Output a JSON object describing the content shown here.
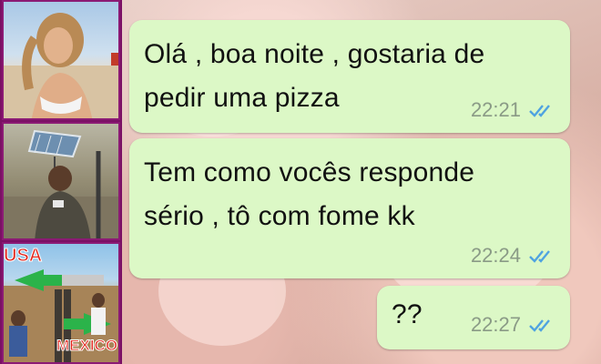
{
  "thumbnails": [
    {
      "name": "woman-on-beach-photo"
    },
    {
      "name": "man-with-solar-panel-photo"
    },
    {
      "name": "usa-mexico-border-photo",
      "labels": {
        "usa": "USA",
        "mexico": "MEXICO"
      }
    }
  ],
  "chat": {
    "messages": [
      {
        "text_line1": "Olá , boa noite , gostaria de",
        "text_line2": "pedir uma pizza",
        "time": "22:21",
        "status": "read"
      },
      {
        "text_line1": "Tem como vocês responde",
        "text_line2": "sério , tô com fome kk",
        "time": "22:24",
        "status": "read"
      },
      {
        "text_line1": "??",
        "time": "22:27",
        "status": "read"
      }
    ]
  },
  "colors": {
    "bubble": "#dcf8c6",
    "tick": "#4fa3e0",
    "sidebar": "#7a0f64"
  }
}
